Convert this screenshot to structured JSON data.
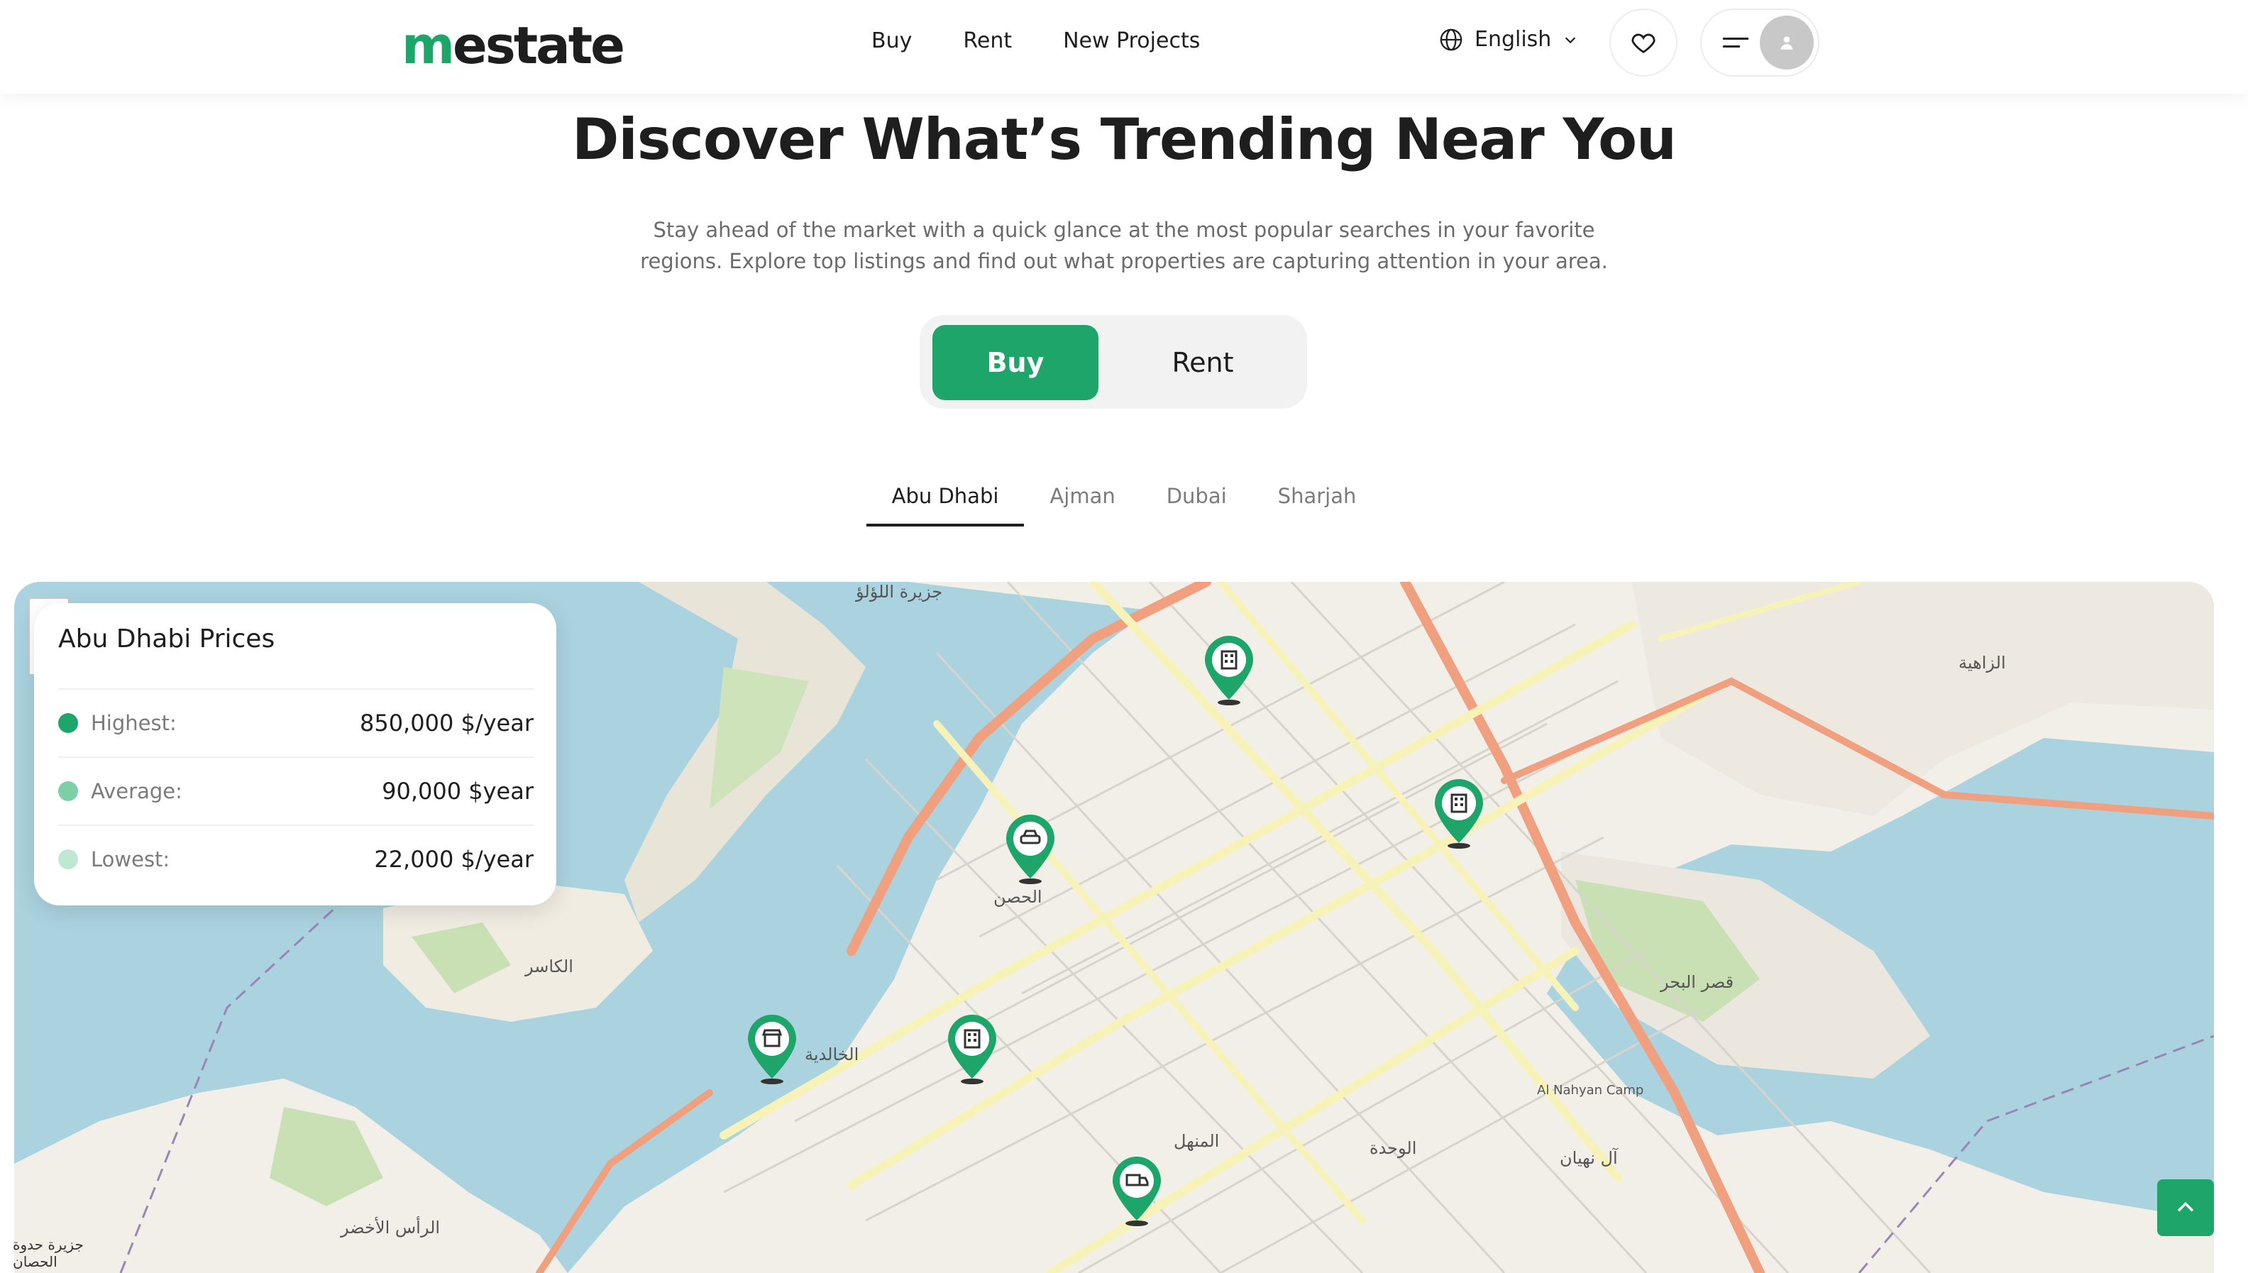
{
  "header": {
    "logo_m": "m",
    "logo_rest": "estate",
    "nav": [
      "Buy",
      "Rent",
      "New Projects"
    ],
    "language": "English"
  },
  "hero": {
    "title": "Discover What’s Trending Near You",
    "subtitle": "Stay ahead of the market with a quick glance at the most popular searches in your favorite regions. Explore top listings and find out what properties are capturing attention in your area."
  },
  "toggle": {
    "buy": "Buy",
    "rent": "Rent",
    "active": "buy"
  },
  "city_tabs": [
    "Abu Dhabi",
    "Ajman",
    "Dubai",
    "Sharjah"
  ],
  "active_city": "Abu Dhabi",
  "prices": {
    "title": "Abu Dhabi Prices",
    "rows": [
      {
        "label": "Highest:",
        "value": "850,000 $/year",
        "color": "#1da56a"
      },
      {
        "label": "Average:",
        "value": "90,000 $year",
        "color": "#7ccfa6"
      },
      {
        "label": "Lowest:",
        "value": "22,000 $/year",
        "color": "#bfe8d3"
      }
    ]
  },
  "map": {
    "labels": [
      "جزيرة اللؤلؤ",
      "الكاسر",
      "الخالدية",
      "الحصن",
      "الزاهية",
      "قصر البحر",
      "المنهل",
      "الوحدة",
      "آل نهيان",
      "Al Nahyan Camp",
      "الرأس الأخضر"
    ],
    "attribution_lines": [
      "جزيرة حدوة",
      "الحصان"
    ],
    "pins": [
      "building-icon",
      "car-icon",
      "building-icon",
      "shop-icon",
      "building-icon",
      "truck-icon"
    ],
    "colors": {
      "water": "#aad3df",
      "land": "#f2efe9",
      "park": "#c8e0b4",
      "major_road": "#f0a07e",
      "road": "#f7f3b8",
      "pin": "#1da56a"
    }
  }
}
